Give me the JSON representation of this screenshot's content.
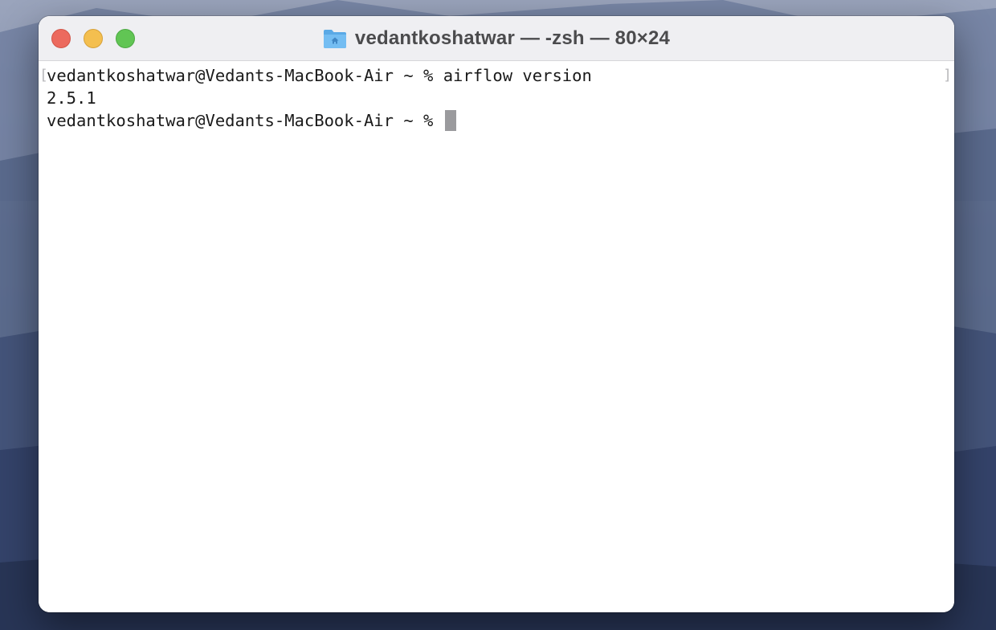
{
  "window": {
    "title": "vedantkoshatwar — -zsh — 80×24",
    "title_icon": "home-folder-icon"
  },
  "terminal": {
    "lines": [
      {
        "prompt": "vedantkoshatwar@Vedants-MacBook-Air ~ % ",
        "command": "airflow version"
      },
      {
        "output": "2.5.1"
      },
      {
        "prompt": "vedantkoshatwar@Vedants-MacBook-Air ~ % ",
        "command": ""
      }
    ],
    "mark_left": "[",
    "mark_right": "]"
  },
  "colors": {
    "close": "#ec6a5e",
    "minimize": "#f4bf4f",
    "zoom": "#61c554",
    "folder": "#5aa9e6"
  }
}
